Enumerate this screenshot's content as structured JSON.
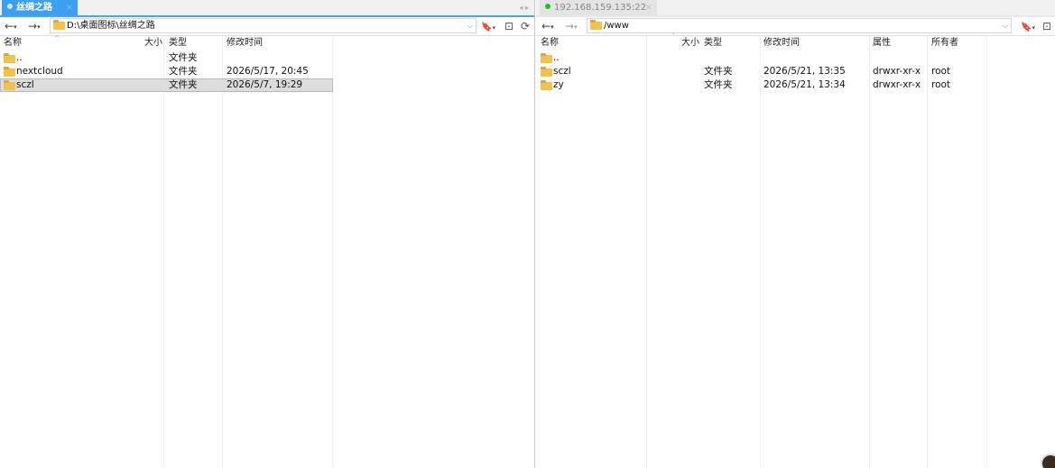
{
  "left": {
    "tab": {
      "label": "丝绸之路",
      "close": "×"
    },
    "tab_nav": "◂ ▸",
    "nav": {
      "back": "←",
      "forward": "→",
      "caret": "▾"
    },
    "address": {
      "path": "D:\\桌面图标\\丝绸之路",
      "dropdown": "⌵"
    },
    "tools": {
      "bookmark": "🔖",
      "bookmark_caret": "▾",
      "newfolder": "⊡",
      "refresh": "⟳"
    },
    "columns": {
      "name": "名称",
      "size": "大小",
      "type": "类型",
      "modified": "修改时间",
      "sort": "^"
    },
    "rows": [
      {
        "name": "..",
        "size": "",
        "type": "文件夹",
        "modified": ""
      },
      {
        "name": "nextcloud",
        "size": "",
        "type": "文件夹",
        "modified": "2026/5/17, 20:45"
      },
      {
        "name": "sczl",
        "size": "",
        "type": "文件夹",
        "modified": "2026/5/7, 19:29"
      }
    ]
  },
  "right": {
    "tab": {
      "label": "192.168.159.135:22",
      "close": "×"
    },
    "nav": {
      "back": "←",
      "forward": "→",
      "caret": "▾"
    },
    "address": {
      "path": "/www",
      "dropdown": "⌵"
    },
    "tools": {
      "bookmark": "🔖",
      "bookmark_caret": "▾",
      "newfolder": "⊡"
    },
    "columns": {
      "name": "名称",
      "size": "大小",
      "type": "类型",
      "modified": "修改时间",
      "attr": "属性",
      "owner": "所有者",
      "sort": "ˇ"
    },
    "rows": [
      {
        "name": "..",
        "size": "",
        "type": "",
        "modified": "",
        "attr": "",
        "owner": ""
      },
      {
        "name": "sczl",
        "size": "",
        "type": "文件夹",
        "modified": "2026/5/21, 13:35",
        "attr": "drwxr-xr-x",
        "owner": "root"
      },
      {
        "name": "zy",
        "size": "",
        "type": "文件夹",
        "modified": "2026/5/21, 13:34",
        "attr": "drwxr-xr-x",
        "owner": "root"
      }
    ]
  },
  "colors": {
    "accent": "#3c9ff0",
    "online": "#19c419",
    "folder": "#f2c14e",
    "selected": "#dcdcdc"
  }
}
